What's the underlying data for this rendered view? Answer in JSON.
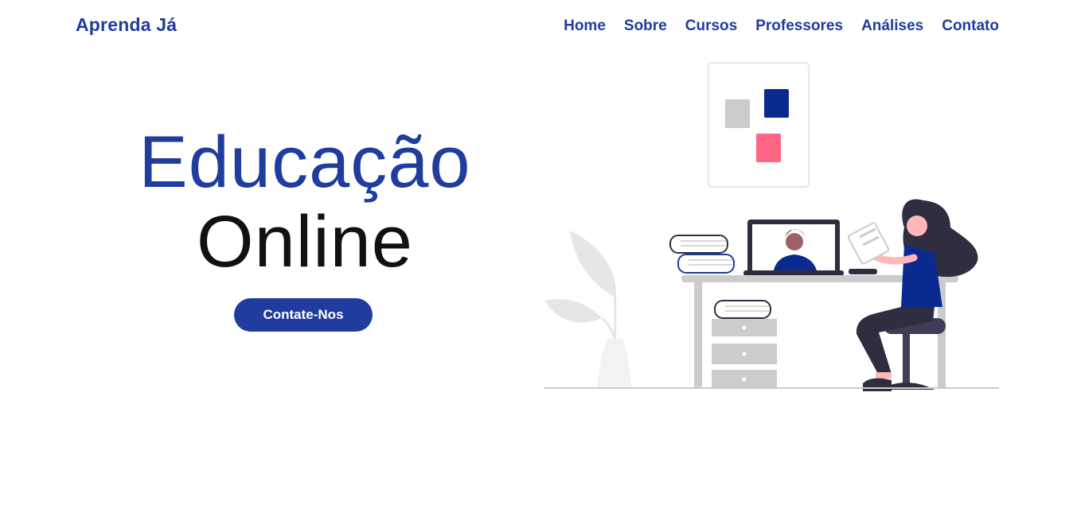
{
  "header": {
    "brand": "Aprenda Já",
    "nav": [
      {
        "label": "Home"
      },
      {
        "label": "Sobre"
      },
      {
        "label": "Cursos"
      },
      {
        "label": "Professores"
      },
      {
        "label": "Análises"
      },
      {
        "label": "Contato"
      }
    ]
  },
  "hero": {
    "title_line1": "Educação",
    "title_line2": "Online",
    "cta_label": "Contate-Nos"
  },
  "illustration": {
    "icon": "online-education-illustration",
    "colors": {
      "primary": "#1f3c9e",
      "accent_pink": "#ff6584",
      "dark": "#2f2e41",
      "gray": "#cccccc",
      "light_gray": "#f2f2f2"
    }
  }
}
